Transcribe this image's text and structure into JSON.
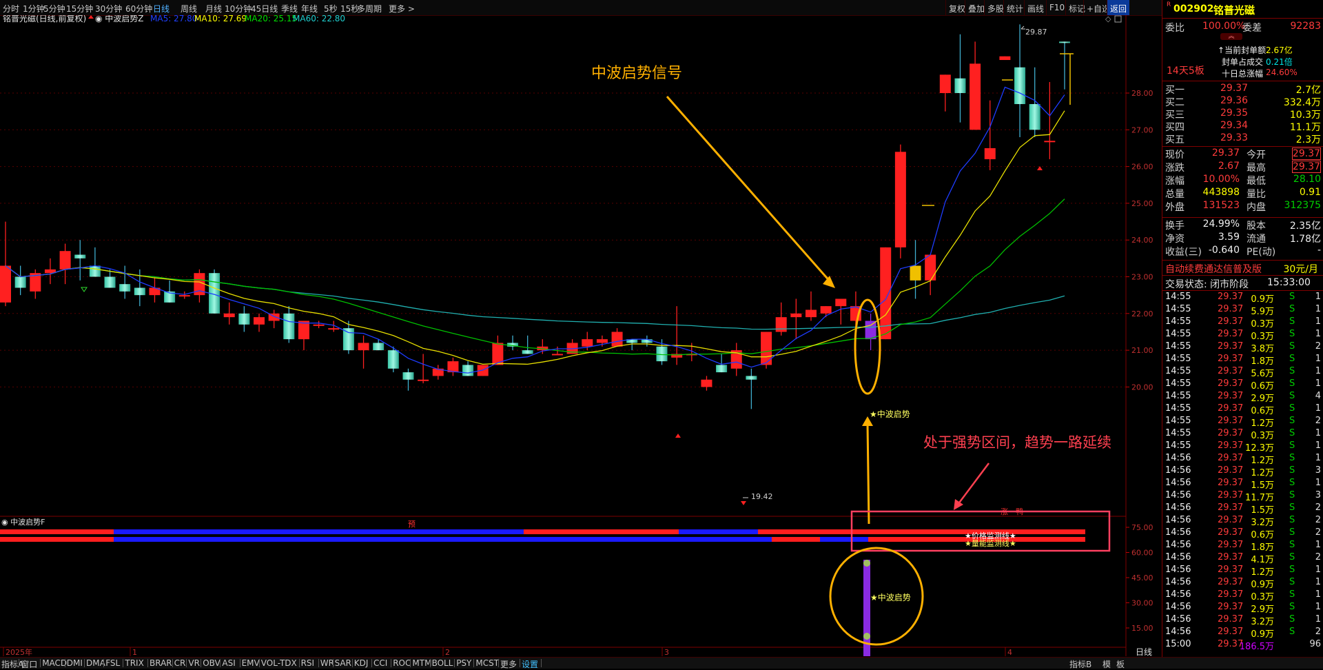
{
  "toolbar": {
    "periods": [
      "分时",
      "1分钟",
      "5分钟",
      "15分钟",
      "30分钟",
      "60分钟",
      "日线",
      "周线",
      "月线",
      "10分钟",
      "45日线",
      "季线",
      "年线",
      "5秒",
      "15秒",
      "多周期",
      "更多 >"
    ],
    "active_period": "日线",
    "right_buttons": [
      "复权",
      "叠加",
      "多股",
      "统计",
      "画线",
      "F10",
      "标记",
      "+自选",
      "返回"
    ],
    "active_right": "返回"
  },
  "stock_header": {
    "name": "铭普光磁(日线,前复权)",
    "indicator": "中波启势Z",
    "ma5": "MA5: 27.80",
    "ma10": "MA10: 27.69",
    "ma20": "MA20: 25.15",
    "ma60": "MA60: 22.80"
  },
  "annotations": {
    "signal_title": "中波启势信号",
    "trend_text": "处于强势区间，趋势一路延续",
    "start_label": "★中波启势",
    "start_label_sub": "★中波启势",
    "price_line": "★价格监测线★",
    "volume_line": "★量能监测线★",
    "high_label": "29.87",
    "low_label": "19.42",
    "limit_text": "涨一鸭",
    "yu_mark": "预"
  },
  "price_axis": [
    "28.00",
    "27.00",
    "26.00",
    "25.00",
    "24.00",
    "23.00",
    "22.00",
    "21.00",
    "20.00"
  ],
  "sub_panel": {
    "title": "中波启势F",
    "axis": [
      "75.00",
      "60.00",
      "45.00",
      "30.00",
      "15.00"
    ]
  },
  "time_axis": {
    "labels": [
      "2025年",
      "1",
      "2",
      "3",
      "4"
    ],
    "right_label": "日线"
  },
  "quote": {
    "code": "002902",
    "name": "铭普光磁",
    "webi_label": "委比",
    "webi_value": "100.00%",
    "wecha_label": "委差",
    "wecha_value": "92283",
    "board_label": "14天5板",
    "seal_amount_label": "当前封单额",
    "seal_amount_value": "2.67亿",
    "seal_ratio_label": "封单占成交",
    "seal_ratio_value": "0.21倍",
    "ten_day_label": "十日总涨幅",
    "ten_day_value": "24.60%",
    "bids": [
      {
        "label": "买一",
        "price": "29.37",
        "vol": "2.7亿"
      },
      {
        "label": "买二",
        "price": "29.36",
        "vol": "332.4万"
      },
      {
        "label": "买三",
        "price": "29.35",
        "vol": "10.3万"
      },
      {
        "label": "买四",
        "price": "29.34",
        "vol": "11.1万"
      },
      {
        "label": "买五",
        "price": "29.33",
        "vol": "2.3万"
      }
    ],
    "stats": [
      {
        "l1": "现价",
        "v1": "29.37",
        "l2": "今开",
        "v2": "29.37"
      },
      {
        "l1": "涨跌",
        "v1": "2.67",
        "l2": "最高",
        "v2": "29.37"
      },
      {
        "l1": "涨幅",
        "v1": "10.00%",
        "l2": "最低",
        "v2": "28.10"
      },
      {
        "l1": "总量",
        "v1": "443898",
        "l2": "量比",
        "v2": "0.91"
      },
      {
        "l1": "外盘",
        "v1": "131523",
        "l2": "内盘",
        "v2": "312375"
      }
    ],
    "stats2": [
      {
        "l1": "换手",
        "v1": "24.99%",
        "l2": "股本",
        "v2": "2.35亿"
      },
      {
        "l1": "净资",
        "v1": "3.59",
        "l2": "流通",
        "v2": "1.78亿"
      },
      {
        "l1": "收益(三)",
        "v1": "-0.640",
        "l2": "PE(动)",
        "v2": "-"
      }
    ],
    "ad_text": "自动续费通达信普及版",
    "ad_price": "30元/月",
    "trade_status_label": "交易状态:",
    "trade_status_value": "闭市阶段",
    "trade_time": "15:33:00",
    "ticks": [
      {
        "t": "14:55",
        "p": "29.37",
        "v": "0.9万",
        "s": "S",
        "n": "1"
      },
      {
        "t": "14:55",
        "p": "29.37",
        "v": "5.9万",
        "s": "S",
        "n": "1"
      },
      {
        "t": "14:55",
        "p": "29.37",
        "v": "0.3万",
        "s": "S",
        "n": "1"
      },
      {
        "t": "14:55",
        "p": "29.37",
        "v": "0.3万",
        "s": "S",
        "n": "1"
      },
      {
        "t": "14:55",
        "p": "29.37",
        "v": "3.8万",
        "s": "S",
        "n": "2"
      },
      {
        "t": "14:55",
        "p": "29.37",
        "v": "1.8万",
        "s": "S",
        "n": "1"
      },
      {
        "t": "14:55",
        "p": "29.37",
        "v": "5.6万",
        "s": "S",
        "n": "1"
      },
      {
        "t": "14:55",
        "p": "29.37",
        "v": "0.6万",
        "s": "S",
        "n": "1"
      },
      {
        "t": "14:55",
        "p": "29.37",
        "v": "2.9万",
        "s": "S",
        "n": "4"
      },
      {
        "t": "14:55",
        "p": "29.37",
        "v": "0.6万",
        "s": "S",
        "n": "1"
      },
      {
        "t": "14:55",
        "p": "29.37",
        "v": "1.2万",
        "s": "S",
        "n": "2"
      },
      {
        "t": "14:55",
        "p": "29.37",
        "v": "0.3万",
        "s": "S",
        "n": "1"
      },
      {
        "t": "14:55",
        "p": "29.37",
        "v": "12.3万",
        "s": "S",
        "n": "1"
      },
      {
        "t": "14:56",
        "p": "29.37",
        "v": "1.2万",
        "s": "S",
        "n": "1"
      },
      {
        "t": "14:56",
        "p": "29.37",
        "v": "1.2万",
        "s": "S",
        "n": "3"
      },
      {
        "t": "14:56",
        "p": "29.37",
        "v": "1.5万",
        "s": "S",
        "n": "1"
      },
      {
        "t": "14:56",
        "p": "29.37",
        "v": "11.7万",
        "s": "S",
        "n": "3"
      },
      {
        "t": "14:56",
        "p": "29.37",
        "v": "1.5万",
        "s": "S",
        "n": "2"
      },
      {
        "t": "14:56",
        "p": "29.37",
        "v": "3.2万",
        "s": "S",
        "n": "2"
      },
      {
        "t": "14:56",
        "p": "29.37",
        "v": "0.6万",
        "s": "S",
        "n": "2"
      },
      {
        "t": "14:56",
        "p": "29.37",
        "v": "1.8万",
        "s": "S",
        "n": "1"
      },
      {
        "t": "14:56",
        "p": "29.37",
        "v": "4.1万",
        "s": "S",
        "n": "2"
      },
      {
        "t": "14:56",
        "p": "29.37",
        "v": "1.2万",
        "s": "S",
        "n": "1"
      },
      {
        "t": "14:56",
        "p": "29.37",
        "v": "0.9万",
        "s": "S",
        "n": "1"
      },
      {
        "t": "14:56",
        "p": "29.37",
        "v": "0.3万",
        "s": "S",
        "n": "1"
      },
      {
        "t": "14:56",
        "p": "29.37",
        "v": "2.9万",
        "s": "S",
        "n": "1"
      },
      {
        "t": "14:56",
        "p": "29.37",
        "v": "3.2万",
        "s": "S",
        "n": "1"
      },
      {
        "t": "14:56",
        "p": "29.37",
        "v": "0.9万",
        "s": "S",
        "n": "2"
      },
      {
        "t": "15:00",
        "p": "29.37",
        "v": "186.5万",
        "s": "",
        "n": "96"
      }
    ]
  },
  "bottom_tabs": [
    "指标A",
    "窗口",
    "MACD",
    "DMI",
    "DMA",
    "FSL",
    "TRIX",
    "BRAR",
    "CR",
    "VR",
    "OBV",
    "ASI",
    "EMV",
    "VOL-TDX",
    "RSI",
    "WR",
    "SAR",
    "KDJ",
    "CCI",
    "ROC",
    "MTM",
    "BOLL",
    "PSY",
    "MCST",
    "更多",
    "设置"
  ],
  "bottom_right": [
    "指标B",
    "模",
    "板"
  ],
  "colors": {
    "up": "#ff2020",
    "down": "#40e0d0",
    "ma5": "#1e3cff",
    "ma10": "#e8e000",
    "ma20": "#00c000",
    "ma60": "#20b0b0",
    "signal": "#8a2be2",
    "annot": "#ffb000",
    "annot2": "#ff4050"
  },
  "candles": [
    {
      "o": 22.3,
      "h": 24.5,
      "l": 22.2,
      "c": 23.3
    },
    {
      "o": 23.0,
      "h": 23.3,
      "l": 22.5,
      "c": 22.7
    },
    {
      "o": 22.6,
      "h": 23.2,
      "l": 22.4,
      "c": 23.1
    },
    {
      "o": 23.1,
      "h": 23.5,
      "l": 22.8,
      "c": 23.2
    },
    {
      "o": 23.2,
      "h": 23.9,
      "l": 22.8,
      "c": 23.7
    },
    {
      "o": 23.6,
      "h": 24.0,
      "l": 22.9,
      "c": 23.5
    },
    {
      "o": 23.3,
      "h": 23.8,
      "l": 23.0,
      "c": 23.0
    },
    {
      "o": 23.0,
      "h": 23.2,
      "l": 22.7,
      "c": 22.7
    },
    {
      "o": 22.8,
      "h": 23.3,
      "l": 22.4,
      "c": 22.6
    },
    {
      "o": 22.7,
      "h": 23.2,
      "l": 22.2,
      "c": 22.5
    },
    {
      "o": 22.5,
      "h": 23.0,
      "l": 22.3,
      "c": 22.7
    },
    {
      "o": 22.6,
      "h": 22.9,
      "l": 22.3,
      "c": 22.3
    },
    {
      "o": 22.5,
      "h": 22.6,
      "l": 22.4,
      "c": 22.5
    },
    {
      "o": 22.5,
      "h": 23.2,
      "l": 22.3,
      "c": 23.1
    },
    {
      "o": 23.1,
      "h": 23.2,
      "l": 22.0,
      "c": 22.0
    },
    {
      "o": 21.9,
      "h": 22.3,
      "l": 21.7,
      "c": 22.0
    },
    {
      "o": 22.0,
      "h": 22.2,
      "l": 21.5,
      "c": 21.7
    },
    {
      "o": 21.7,
      "h": 22.0,
      "l": 21.5,
      "c": 21.9
    },
    {
      "o": 21.8,
      "h": 22.1,
      "l": 21.6,
      "c": 22.0
    },
    {
      "o": 22.0,
      "h": 22.2,
      "l": 21.2,
      "c": 21.3
    },
    {
      "o": 21.3,
      "h": 21.8,
      "l": 21.0,
      "c": 21.8
    },
    {
      "o": 21.7,
      "h": 21.8,
      "l": 21.6,
      "c": 21.7
    },
    {
      "o": 21.6,
      "h": 21.8,
      "l": 21.5,
      "c": 21.6
    },
    {
      "o": 21.6,
      "h": 21.8,
      "l": 20.9,
      "c": 21.0
    },
    {
      "o": 21.0,
      "h": 21.4,
      "l": 20.5,
      "c": 21.2
    },
    {
      "o": 21.2,
      "h": 21.3,
      "l": 21.0,
      "c": 21.0
    },
    {
      "o": 21.0,
      "h": 21.1,
      "l": 20.4,
      "c": 20.5
    },
    {
      "o": 20.4,
      "h": 20.5,
      "l": 19.9,
      "c": 20.2
    },
    {
      "o": 20.2,
      "h": 20.9,
      "l": 20.1,
      "c": 20.2
    },
    {
      "o": 20.3,
      "h": 20.6,
      "l": 20.2,
      "c": 20.5
    },
    {
      "o": 20.4,
      "h": 20.8,
      "l": 20.3,
      "c": 20.7
    },
    {
      "o": 20.6,
      "h": 20.7,
      "l": 20.3,
      "c": 20.3
    },
    {
      "o": 20.3,
      "h": 20.6,
      "l": 20.3,
      "c": 20.6
    },
    {
      "o": 20.6,
      "h": 21.4,
      "l": 20.6,
      "c": 21.2
    },
    {
      "o": 21.2,
      "h": 21.4,
      "l": 21.0,
      "c": 21.1
    },
    {
      "o": 21.0,
      "h": 21.4,
      "l": 20.9,
      "c": 20.9
    },
    {
      "o": 21.0,
      "h": 21.3,
      "l": 20.9,
      "c": 21.1
    },
    {
      "o": 20.9,
      "h": 21.1,
      "l": 20.9,
      "c": 20.9
    },
    {
      "o": 20.9,
      "h": 21.3,
      "l": 20.9,
      "c": 21.2
    },
    {
      "o": 21.1,
      "h": 21.5,
      "l": 21.0,
      "c": 21.3
    },
    {
      "o": 21.2,
      "h": 21.4,
      "l": 21.1,
      "c": 21.3
    },
    {
      "o": 21.1,
      "h": 21.6,
      "l": 21.1,
      "c": 21.5
    },
    {
      "o": 21.3,
      "h": 21.3,
      "l": 21.0,
      "c": 21.2
    },
    {
      "o": 21.3,
      "h": 21.4,
      "l": 21.1,
      "c": 21.2
    },
    {
      "o": 21.1,
      "h": 21.3,
      "l": 20.6,
      "c": 20.7
    },
    {
      "o": 20.8,
      "h": 22.2,
      "l": 20.6,
      "c": 20.9
    },
    {
      "o": 20.9,
      "h": 21.2,
      "l": 20.7,
      "c": 20.9
    },
    {
      "o": 20.0,
      "h": 20.3,
      "l": 19.9,
      "c": 20.2
    },
    {
      "o": 20.6,
      "h": 20.9,
      "l": 20.4,
      "c": 20.4
    },
    {
      "o": 20.5,
      "h": 21.2,
      "l": 20.3,
      "c": 21.0
    },
    {
      "o": 20.3,
      "h": 20.5,
      "l": 19.4,
      "c": 20.2
    },
    {
      "o": 20.6,
      "h": 21.5,
      "l": 20.5,
      "c": 21.5
    },
    {
      "o": 21.5,
      "h": 22.3,
      "l": 21.4,
      "c": 21.9
    },
    {
      "o": 21.9,
      "h": 22.4,
      "l": 21.3,
      "c": 22.0
    },
    {
      "o": 21.9,
      "h": 22.6,
      "l": 21.8,
      "c": 22.1
    },
    {
      "o": 22.0,
      "h": 22.2,
      "l": 21.9,
      "c": 22.2
    },
    {
      "o": 22.2,
      "h": 22.3,
      "l": 21.7,
      "c": 22.4
    },
    {
      "o": 21.8,
      "h": 22.6,
      "l": 21.0,
      "c": 22.2
    },
    {
      "o": 21.8,
      "h": 22.0,
      "l": 21.0,
      "c": 21.3
    },
    {
      "o": 21.3,
      "h": 23.8,
      "l": 21.3,
      "c": 23.8
    },
    {
      "o": 23.8,
      "h": 26.6,
      "l": 23.5,
      "c": 26.4
    },
    {
      "o": 23.3,
      "h": 24.0,
      "l": 22.4,
      "c": 22.9
    },
    {
      "o": 22.9,
      "h": 23.6,
      "l": 22.5,
      "c": 23.6
    },
    {
      "o": 28.0,
      "h": 28.5,
      "l": 27.5,
      "c": 28.5
    },
    {
      "o": 28.4,
      "h": 29.6,
      "l": 27.2,
      "c": 28.0
    },
    {
      "o": 27.0,
      "h": 29.4,
      "l": 27.0,
      "c": 28.8
    },
    {
      "o": 26.2,
      "h": 27.8,
      "l": 25.9,
      "c": 26.5
    },
    {
      "o": 28.9,
      "h": 29.0,
      "l": 28.9,
      "c": 29.0
    },
    {
      "o": 28.7,
      "h": 29.87,
      "l": 26.8,
      "c": 27.7
    },
    {
      "o": 27.7,
      "h": 28.7,
      "l": 26.8,
      "c": 27.0
    },
    {
      "o": 26.7,
      "h": 28.3,
      "l": 26.2,
      "c": 26.7
    },
    {
      "o": 29.4,
      "h": 29.4,
      "l": 28.1,
      "c": 29.37
    }
  ]
}
